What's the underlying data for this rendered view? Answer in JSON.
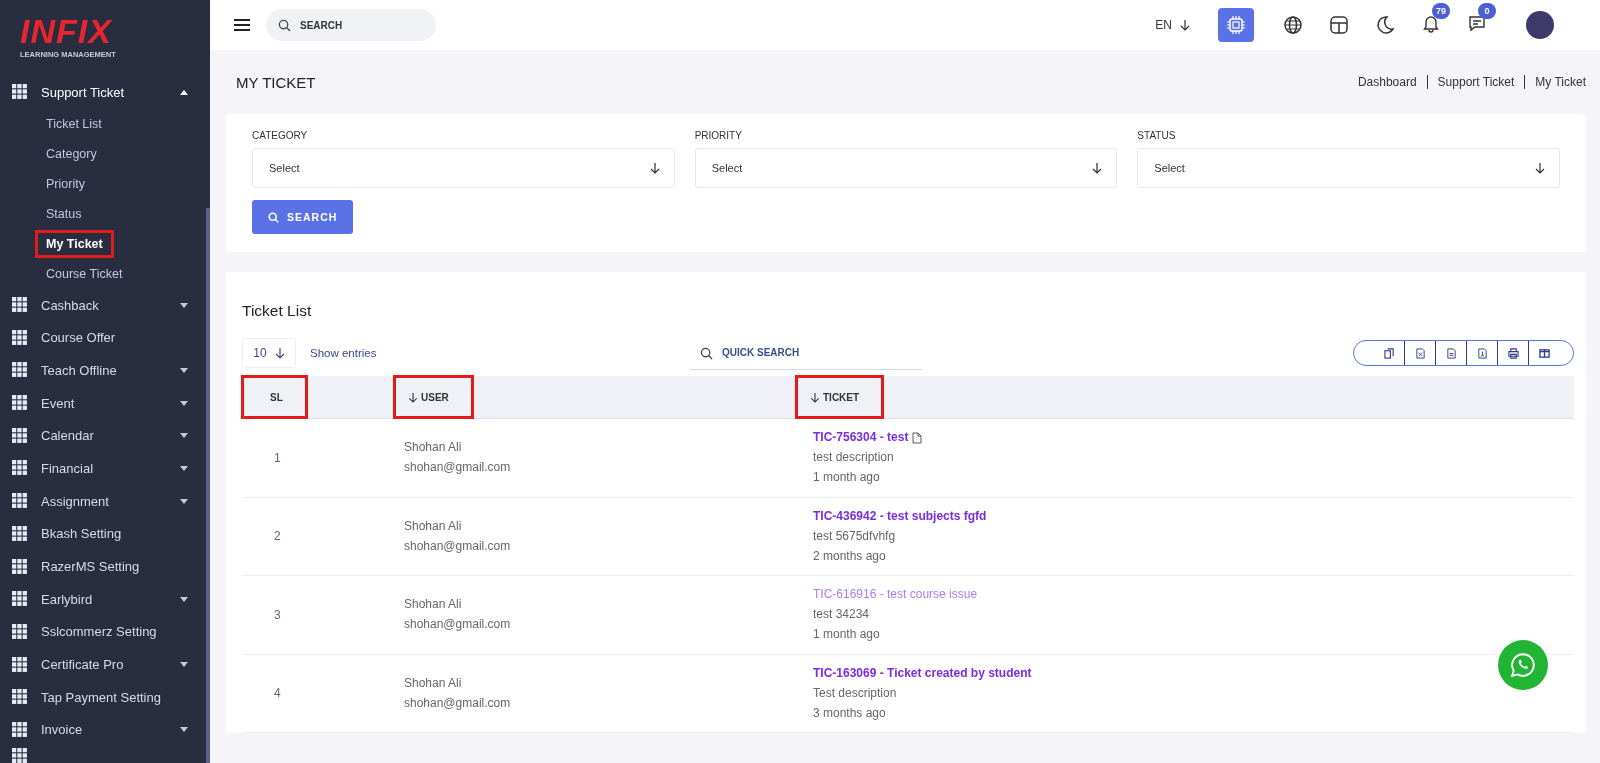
{
  "logo": {
    "brand": "INFIX",
    "tagline": "LEARNING MANAGEMENT"
  },
  "sidebar": {
    "items": [
      {
        "label": "Support Ticket",
        "expandable": true,
        "expanded": true,
        "children": [
          {
            "label": "Ticket List",
            "selected": false,
            "highlighted": false
          },
          {
            "label": "Category",
            "selected": false,
            "highlighted": false
          },
          {
            "label": "Priority",
            "selected": false,
            "highlighted": false
          },
          {
            "label": "Status",
            "selected": false,
            "highlighted": false
          },
          {
            "label": "My Ticket",
            "selected": true,
            "highlighted": true
          },
          {
            "label": "Course Ticket",
            "selected": false,
            "highlighted": false
          }
        ]
      },
      {
        "label": "Cashback",
        "expandable": true,
        "expanded": false
      },
      {
        "label": "Course Offer",
        "expandable": false,
        "expanded": false
      },
      {
        "label": "Teach Offline",
        "expandable": true,
        "expanded": false
      },
      {
        "label": "Event",
        "expandable": true,
        "expanded": false
      },
      {
        "label": "Calendar",
        "expandable": true,
        "expanded": false
      },
      {
        "label": "Financial",
        "expandable": true,
        "expanded": false
      },
      {
        "label": "Assignment",
        "expandable": true,
        "expanded": false
      },
      {
        "label": "Bkash Setting",
        "expandable": false,
        "expanded": false
      },
      {
        "label": "RazerMS Setting",
        "expandable": false,
        "expanded": false
      },
      {
        "label": "Earlybird",
        "expandable": true,
        "expanded": false
      },
      {
        "label": "Sslcommerz Setting",
        "expandable": false,
        "expanded": false
      },
      {
        "label": "Certificate Pro",
        "expandable": true,
        "expanded": false
      },
      {
        "label": "Tap Payment Setting",
        "expandable": false,
        "expanded": false
      },
      {
        "label": "Invoice",
        "expandable": true,
        "expanded": false
      }
    ]
  },
  "header": {
    "search": {
      "placeholder": "SEARCH"
    },
    "language": "EN",
    "notifications": "79",
    "messages": "0"
  },
  "page": {
    "title": "MY TICKET",
    "breadcrumbs": [
      "Dashboard",
      "Support Ticket",
      "My Ticket"
    ]
  },
  "filters": [
    {
      "label": "CATEGORY",
      "value": "Select"
    },
    {
      "label": "PRIORITY",
      "value": "Select"
    },
    {
      "label": "STATUS",
      "value": "Select"
    }
  ],
  "search_button": "SEARCH",
  "ticket_list": {
    "title": "Ticket List",
    "page_size": "10",
    "show_entries": "Show entries",
    "quick_search": {
      "placeholder": "QUICK SEARCH"
    },
    "columns": [
      {
        "label": "SL",
        "sortable": false,
        "highlighted": true
      },
      {
        "label": "USER",
        "sortable": true,
        "highlighted": true
      },
      {
        "label": "TICKET",
        "sortable": true,
        "highlighted": true
      }
    ],
    "rows": [
      {
        "sl": "1",
        "name": "Shohan Ali",
        "email": "shohan@gmail.com",
        "ticket": "TIC-756304 - test",
        "attachment": true,
        "unread": true,
        "description": "test description",
        "time": "1 month ago"
      },
      {
        "sl": "2",
        "name": "Shohan Ali",
        "email": "shohan@gmail.com",
        "ticket": "TIC-436942 - test subjects fgfd",
        "attachment": false,
        "unread": true,
        "description": "test 5675dfvhfg",
        "time": "2 months ago"
      },
      {
        "sl": "3",
        "name": "Shohan Ali",
        "email": "shohan@gmail.com",
        "ticket": "TIC-616916 - test course issue",
        "attachment": false,
        "unread": false,
        "description": "test 34234",
        "time": "1 month ago"
      },
      {
        "sl": "4",
        "name": "Shohan Ali",
        "email": "shohan@gmail.com",
        "ticket": "TIC-163069 - Ticket created by student",
        "attachment": false,
        "unread": true,
        "description": "Test description",
        "time": "3 months ago"
      }
    ]
  }
}
